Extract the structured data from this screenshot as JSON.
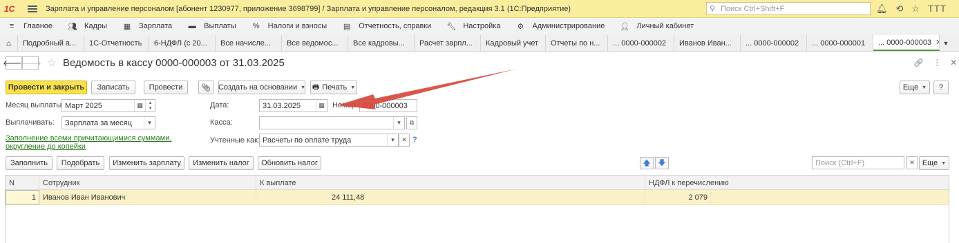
{
  "titlebar": {
    "logo": "1С",
    "title": "Зарплата и управление персоналом [абонент 1230977, приложение 3698799] / Зарплата и управление персоналом, редакция 3.1  (1С:Предприятие)",
    "search_placeholder": "Поиск Ctrl+Shift+F",
    "user": "ТТТ",
    "icons": [
      "bell-icon",
      "history-icon",
      "star-icon"
    ]
  },
  "sections": [
    {
      "label": "Главное",
      "icon": "hamburger-icon"
    },
    {
      "label": "Кадры",
      "icon": "people-icon"
    },
    {
      "label": "Зарплата",
      "icon": "calculator-icon"
    },
    {
      "label": "Выплаты",
      "icon": "wallet-icon"
    },
    {
      "label": "Налоги и взносы",
      "icon": "percent-icon"
    },
    {
      "label": "Отчетность, справки",
      "icon": "report-icon"
    },
    {
      "label": "Настройка",
      "icon": "wrench-icon"
    },
    {
      "label": "Администрирование",
      "icon": "gear-icon"
    },
    {
      "label": "Личный кабинет",
      "icon": "person-icon"
    }
  ],
  "open_tabs": [
    "Подробный а...",
    "1С-Отчетность",
    "6-НДФЛ (с 20...",
    "Все начисле...",
    "Все ведомос...",
    "Все кадровы...",
    "Расчет зарпл...",
    "Кадровый учет",
    "Отчеты по н...",
    "... 0000-000002",
    "Иванов Иван...",
    "... 0000-000002",
    "... 0000-000001",
    "... 0000-000003"
  ],
  "form": {
    "title": "Ведомость в кассу 0000-000003 от 31.03.2025",
    "buttons": {
      "post_close": "Провести и закрыть",
      "save": "Записать",
      "post": "Провести",
      "create_based": "Создать на основании",
      "print": "Печать",
      "more": "Еще"
    },
    "fields": {
      "month_label": "Месяц выплаты:",
      "month_value": "Март 2025",
      "date_label": "Дата:",
      "date_value": "31.03.2025",
      "number_label": "Номер:",
      "number_value": "0000-000003",
      "pay_label": "Выплачивать:",
      "pay_value": "Зарплата за месяц",
      "cash_label": "Касса:",
      "cash_value": "",
      "accounted_label": "Учтенные как:",
      "accounted_value": "Расчеты по оплате труда",
      "help": "?"
    },
    "fill_link": "Заполнение всеми причитающимися суммами, округление до копейки"
  },
  "table_toolbar": {
    "fill": "Заполнить",
    "pick": "Подобрать",
    "change_salary": "Изменить зарплату",
    "change_tax": "Изменить налог",
    "update_tax": "Обновить налог",
    "search_placeholder": "Поиск (Ctrl+F)",
    "more": "Еще"
  },
  "table": {
    "columns": [
      "N",
      "Сотрудник",
      "К выплате",
      "НДФЛ к перечислению"
    ],
    "rows": [
      {
        "n": "1",
        "employee": "Иванов Иван Иванович",
        "payment": "24 111,48",
        "ndfl": "2 079"
      }
    ]
  },
  "colors": {
    "titlebar": "#fbed9e",
    "primary_button": "#fce24a",
    "selected_row": "#fbf1c7",
    "link": "#2c7a1f",
    "annotation_arrow": "#d8473c"
  }
}
